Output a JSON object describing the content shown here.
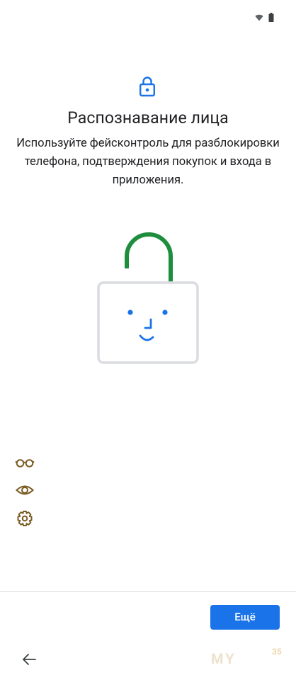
{
  "status_bar": {
    "wifi_icon": "wifi-icon",
    "battery_icon": "battery-icon"
  },
  "header": {
    "icon": "lock-icon",
    "title": "Распознавание лица",
    "subtitle": "Используйте фейсконтроль для разблокировки телефона, подтверждения покупок и входа в приложения."
  },
  "illustration": {
    "icon": "unlocked-padlock-face-icon"
  },
  "features": [
    {
      "icon": "glasses-icon"
    },
    {
      "icon": "eye-icon"
    },
    {
      "icon": "gear-icon"
    }
  ],
  "footer": {
    "more_button_label": "Ещё",
    "back_icon": "arrow-back-icon"
  },
  "watermark": {
    "text": "MY",
    "badge": "35"
  },
  "colors": {
    "accent_blue": "#1a73e8",
    "shackle_green": "#1e8e3e",
    "feature_icon_brown": "#7a5b23",
    "frame_gray": "#dadce0"
  }
}
